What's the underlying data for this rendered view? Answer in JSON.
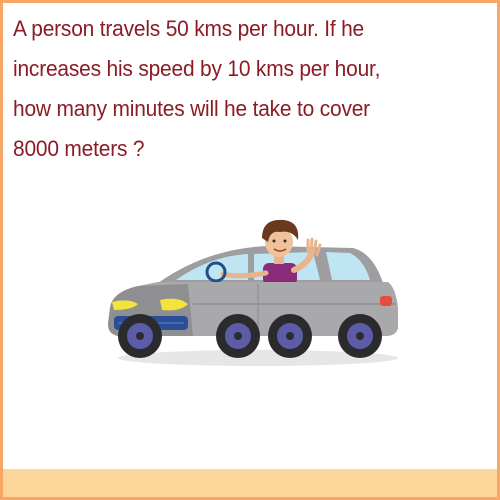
{
  "question": {
    "lines": [
      "A person travels 50 kms per hour. If he",
      "increases his speed by 10 kms per hour,",
      "how many minutes will he take to cover",
      "8000 meters ?"
    ]
  },
  "illustration": {
    "icon": "car-with-driver-icon"
  },
  "colors": {
    "text": "#8b1c24",
    "border": "#f7a765",
    "bottom_band": "#fdd69a",
    "car_body": "#a9a9ab",
    "headlight": "#f2e43a"
  }
}
